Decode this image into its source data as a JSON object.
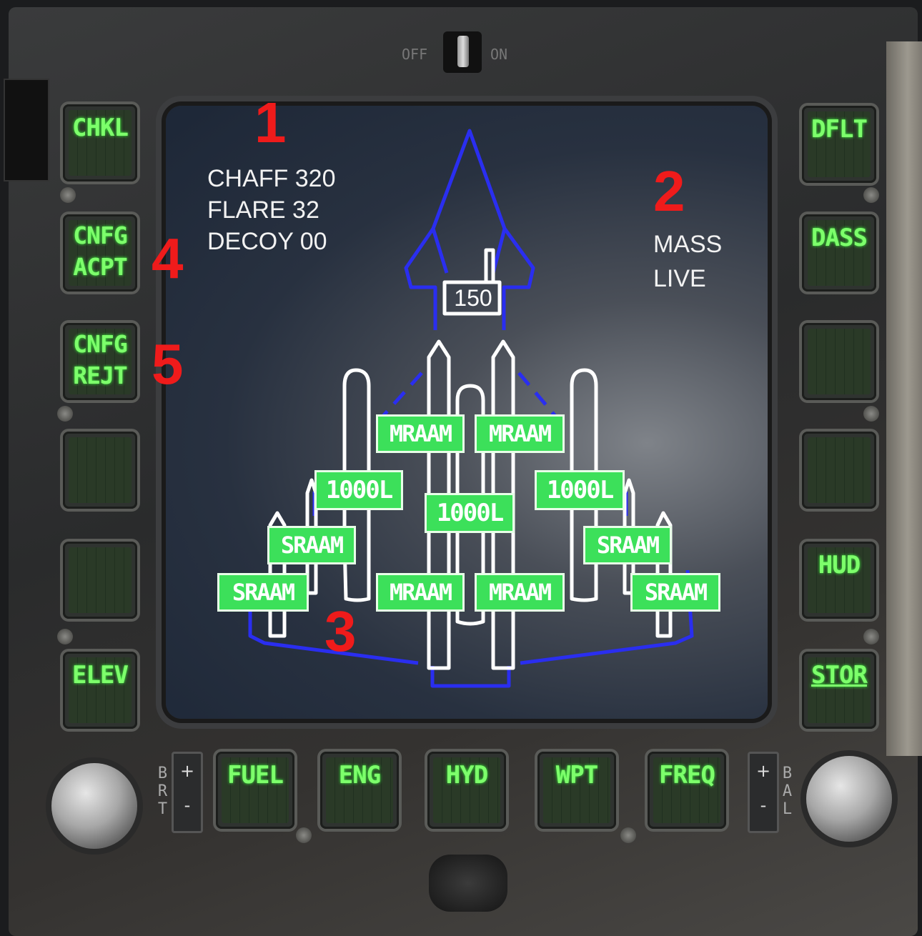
{
  "power_switch": {
    "off_label": "OFF",
    "on_label": "ON"
  },
  "left_osbs": [
    {
      "label": "CHKL"
    },
    {
      "label": "CNFG\nACPT"
    },
    {
      "label": "CNFG\nREJT"
    },
    {
      "label": ""
    },
    {
      "label": ""
    },
    {
      "label": "ELEV"
    }
  ],
  "right_osbs": [
    {
      "label": "DFLT"
    },
    {
      "label": "DASS"
    },
    {
      "label": ""
    },
    {
      "label": ""
    },
    {
      "label": "HUD"
    },
    {
      "label": "STOR"
    }
  ],
  "bottom_osbs": [
    {
      "label": "FUEL"
    },
    {
      "label": "ENG"
    },
    {
      "label": "HYD"
    },
    {
      "label": "WPT"
    },
    {
      "label": "FREQ"
    }
  ],
  "brightness": {
    "label": "BRT",
    "plus": "+",
    "minus": "-"
  },
  "balance": {
    "label": "BAL",
    "plus": "+",
    "minus": "-"
  },
  "countermeasures": {
    "chaff": "CHAFF 320",
    "flare": "FLARE 32",
    "decoy": "DECOY 00"
  },
  "arm_mode": {
    "line1": "MASS",
    "line2": "LIVE"
  },
  "gun_rounds": "150",
  "stores": {
    "inner_left_fwd": "MRAAM",
    "inner_right_fwd": "MRAAM",
    "left_tank": "1000L",
    "right_tank": "1000L",
    "center_tank": "1000L",
    "left_mid": "SRAAM",
    "right_mid": "SRAAM",
    "left_outer": "SRAAM",
    "right_outer": "SRAAM",
    "inner_left_aft": "MRAAM",
    "inner_right_aft": "MRAAM"
  },
  "annotations": [
    "1",
    "2",
    "3",
    "4",
    "5"
  ],
  "colors": {
    "osb_text": "#7dff6b",
    "store_label_bg": "#3ce05a",
    "airframe_outline": "#2a2ef0",
    "store_outline": "#ffffff",
    "annotation": "#ef1b1b"
  }
}
